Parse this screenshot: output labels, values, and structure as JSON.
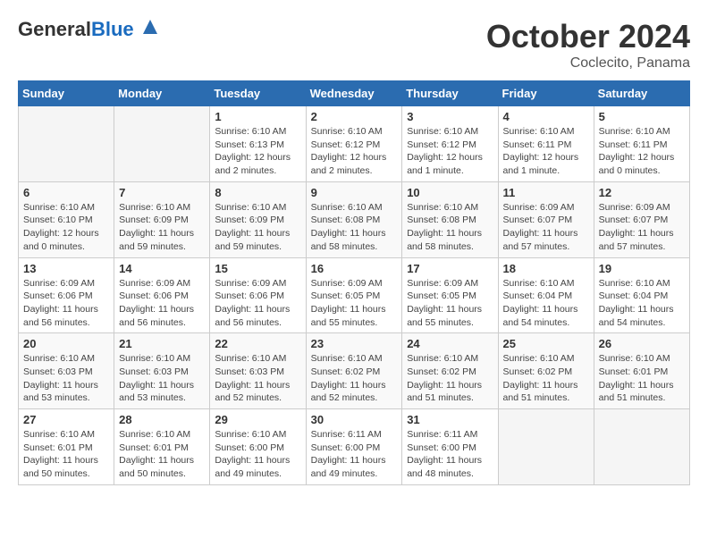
{
  "header": {
    "logo_general": "General",
    "logo_blue": "Blue",
    "month": "October 2024",
    "location": "Coclecito, Panama"
  },
  "weekdays": [
    "Sunday",
    "Monday",
    "Tuesday",
    "Wednesday",
    "Thursday",
    "Friday",
    "Saturday"
  ],
  "weeks": [
    [
      {
        "day": "",
        "info": ""
      },
      {
        "day": "",
        "info": ""
      },
      {
        "day": "1",
        "info": "Sunrise: 6:10 AM\nSunset: 6:13 PM\nDaylight: 12 hours\nand 2 minutes."
      },
      {
        "day": "2",
        "info": "Sunrise: 6:10 AM\nSunset: 6:12 PM\nDaylight: 12 hours\nand 2 minutes."
      },
      {
        "day": "3",
        "info": "Sunrise: 6:10 AM\nSunset: 6:12 PM\nDaylight: 12 hours\nand 1 minute."
      },
      {
        "day": "4",
        "info": "Sunrise: 6:10 AM\nSunset: 6:11 PM\nDaylight: 12 hours\nand 1 minute."
      },
      {
        "day": "5",
        "info": "Sunrise: 6:10 AM\nSunset: 6:11 PM\nDaylight: 12 hours\nand 0 minutes."
      }
    ],
    [
      {
        "day": "6",
        "info": "Sunrise: 6:10 AM\nSunset: 6:10 PM\nDaylight: 12 hours\nand 0 minutes."
      },
      {
        "day": "7",
        "info": "Sunrise: 6:10 AM\nSunset: 6:09 PM\nDaylight: 11 hours\nand 59 minutes."
      },
      {
        "day": "8",
        "info": "Sunrise: 6:10 AM\nSunset: 6:09 PM\nDaylight: 11 hours\nand 59 minutes."
      },
      {
        "day": "9",
        "info": "Sunrise: 6:10 AM\nSunset: 6:08 PM\nDaylight: 11 hours\nand 58 minutes."
      },
      {
        "day": "10",
        "info": "Sunrise: 6:10 AM\nSunset: 6:08 PM\nDaylight: 11 hours\nand 58 minutes."
      },
      {
        "day": "11",
        "info": "Sunrise: 6:09 AM\nSunset: 6:07 PM\nDaylight: 11 hours\nand 57 minutes."
      },
      {
        "day": "12",
        "info": "Sunrise: 6:09 AM\nSunset: 6:07 PM\nDaylight: 11 hours\nand 57 minutes."
      }
    ],
    [
      {
        "day": "13",
        "info": "Sunrise: 6:09 AM\nSunset: 6:06 PM\nDaylight: 11 hours\nand 56 minutes."
      },
      {
        "day": "14",
        "info": "Sunrise: 6:09 AM\nSunset: 6:06 PM\nDaylight: 11 hours\nand 56 minutes."
      },
      {
        "day": "15",
        "info": "Sunrise: 6:09 AM\nSunset: 6:06 PM\nDaylight: 11 hours\nand 56 minutes."
      },
      {
        "day": "16",
        "info": "Sunrise: 6:09 AM\nSunset: 6:05 PM\nDaylight: 11 hours\nand 55 minutes."
      },
      {
        "day": "17",
        "info": "Sunrise: 6:09 AM\nSunset: 6:05 PM\nDaylight: 11 hours\nand 55 minutes."
      },
      {
        "day": "18",
        "info": "Sunrise: 6:10 AM\nSunset: 6:04 PM\nDaylight: 11 hours\nand 54 minutes."
      },
      {
        "day": "19",
        "info": "Sunrise: 6:10 AM\nSunset: 6:04 PM\nDaylight: 11 hours\nand 54 minutes."
      }
    ],
    [
      {
        "day": "20",
        "info": "Sunrise: 6:10 AM\nSunset: 6:03 PM\nDaylight: 11 hours\nand 53 minutes."
      },
      {
        "day": "21",
        "info": "Sunrise: 6:10 AM\nSunset: 6:03 PM\nDaylight: 11 hours\nand 53 minutes."
      },
      {
        "day": "22",
        "info": "Sunrise: 6:10 AM\nSunset: 6:03 PM\nDaylight: 11 hours\nand 52 minutes."
      },
      {
        "day": "23",
        "info": "Sunrise: 6:10 AM\nSunset: 6:02 PM\nDaylight: 11 hours\nand 52 minutes."
      },
      {
        "day": "24",
        "info": "Sunrise: 6:10 AM\nSunset: 6:02 PM\nDaylight: 11 hours\nand 51 minutes."
      },
      {
        "day": "25",
        "info": "Sunrise: 6:10 AM\nSunset: 6:02 PM\nDaylight: 11 hours\nand 51 minutes."
      },
      {
        "day": "26",
        "info": "Sunrise: 6:10 AM\nSunset: 6:01 PM\nDaylight: 11 hours\nand 51 minutes."
      }
    ],
    [
      {
        "day": "27",
        "info": "Sunrise: 6:10 AM\nSunset: 6:01 PM\nDaylight: 11 hours\nand 50 minutes."
      },
      {
        "day": "28",
        "info": "Sunrise: 6:10 AM\nSunset: 6:01 PM\nDaylight: 11 hours\nand 50 minutes."
      },
      {
        "day": "29",
        "info": "Sunrise: 6:10 AM\nSunset: 6:00 PM\nDaylight: 11 hours\nand 49 minutes."
      },
      {
        "day": "30",
        "info": "Sunrise: 6:11 AM\nSunset: 6:00 PM\nDaylight: 11 hours\nand 49 minutes."
      },
      {
        "day": "31",
        "info": "Sunrise: 6:11 AM\nSunset: 6:00 PM\nDaylight: 11 hours\nand 48 minutes."
      },
      {
        "day": "",
        "info": ""
      },
      {
        "day": "",
        "info": ""
      }
    ]
  ]
}
